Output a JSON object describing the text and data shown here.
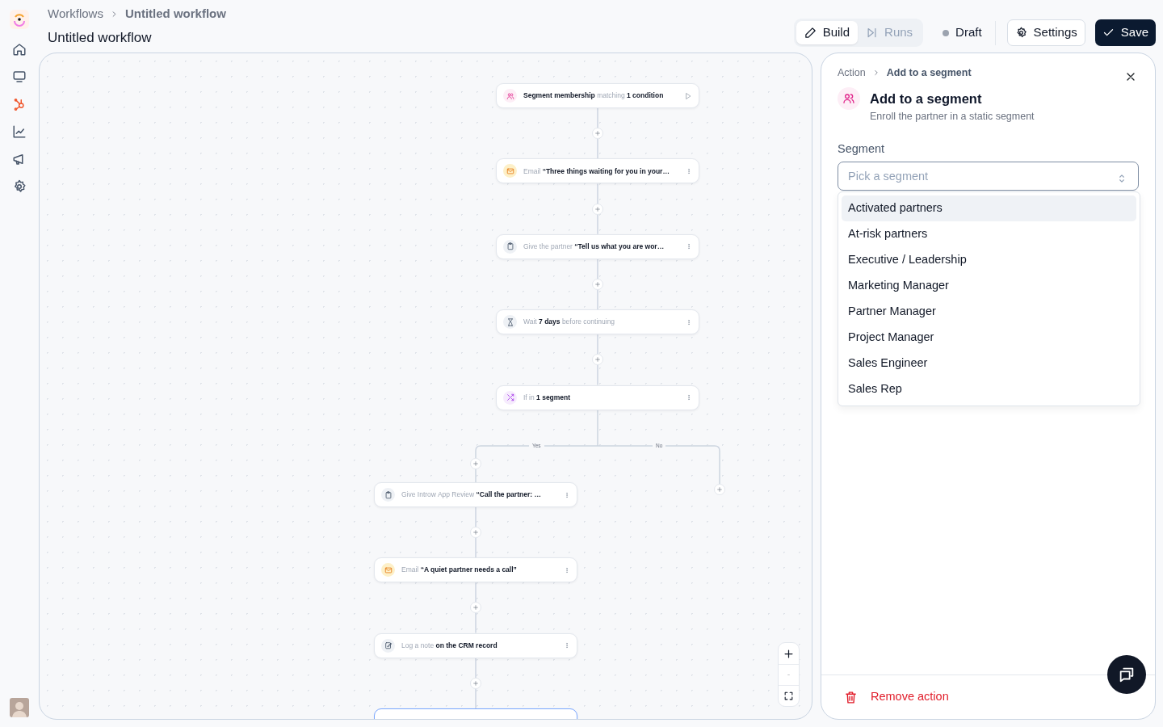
{
  "sidebar": {
    "items": [
      {
        "kind": "home"
      },
      {
        "kind": "monitor"
      },
      {
        "kind": "hub"
      },
      {
        "kind": "chart"
      },
      {
        "kind": "megaphone"
      },
      {
        "kind": "settings"
      }
    ]
  },
  "header": {
    "breadcrumb": [
      "Workflows",
      "Untitled workflow"
    ],
    "title": "Untitled workflow"
  },
  "mode_tabs": [
    {
      "label": "Build",
      "kind": "build",
      "selected": true
    },
    {
      "label": "Runs",
      "kind": "runs",
      "selected": false
    }
  ],
  "status": "Draft",
  "buttons": {
    "settings": "Settings",
    "save": "Save"
  },
  "steps": [
    {
      "kind": "trigger",
      "text": "**Segment membership** matching **1 condition**"
    },
    {
      "kind": "email",
      "text": "Email **“Three things waiting for you in your…**"
    },
    {
      "kind": "task",
      "text": "Give the partner **“Tell us what you are wor…**"
    },
    {
      "kind": "wait",
      "text": "Wait **7 days** before continuing"
    },
    {
      "kind": "condition",
      "text": "If in **1 segment**"
    }
  ],
  "branch": {
    "yes_label": "Yes",
    "no_label": "No",
    "yes_steps": [
      {
        "kind": "task",
        "text": "Give Introw App Review **“Call the partner: …**",
        "selected": false
      },
      {
        "kind": "email",
        "text": "Email **“A quiet partner needs a call”**",
        "selected": false
      },
      {
        "kind": "note",
        "text": "Log a note **on the CRM record**",
        "selected": false
      },
      {
        "kind": "pending",
        "selected": true
      }
    ]
  },
  "panel": {
    "breadcrumb": [
      "Action",
      "Add to a segment"
    ],
    "title": "Add to a segment",
    "subtitle": "Enroll the partner in a static segment",
    "field_label": "Segment",
    "placeholder": "Pick a segment",
    "options": [
      {
        "label": "Activated partners",
        "selected": true
      },
      {
        "label": "At-risk partners",
        "selected": false
      },
      {
        "label": "Executive / Leadership",
        "selected": false
      },
      {
        "label": "Marketing Manager",
        "selected": false
      },
      {
        "label": "Partner Manager",
        "selected": false
      },
      {
        "label": "Project Manager",
        "selected": false
      },
      {
        "label": "Sales Engineer",
        "selected": false
      },
      {
        "label": "Sales Rep",
        "selected": false
      }
    ],
    "remove": "Remove action"
  }
}
